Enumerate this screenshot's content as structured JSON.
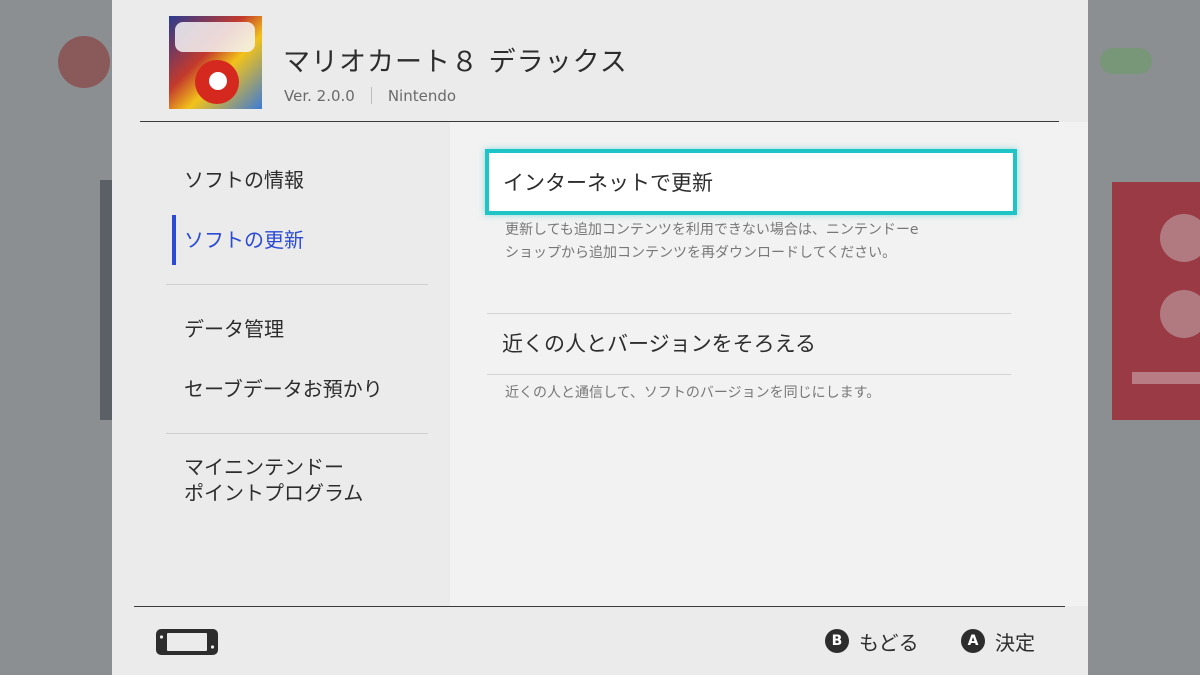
{
  "game": {
    "title": "マリオカート８ デラックス",
    "version": "Ver. 2.0.0",
    "publisher": "Nintendo"
  },
  "sidebar": {
    "items": [
      {
        "label": "ソフトの情報"
      },
      {
        "label": "ソフトの更新"
      },
      {
        "label": "データ管理"
      },
      {
        "label": "セーブデータお預かり"
      },
      {
        "label_line1": "マイニンテンドー",
        "label_line2": "ポイントプログラム"
      }
    ]
  },
  "content": {
    "option1": {
      "label": "インターネットで更新",
      "desc_line1": "更新しても追加コンテンツを利用できない場合は、ニンテンドーe",
      "desc_line2": "ショップから追加コンテンツを再ダウンロードしてください。"
    },
    "option2": {
      "label": "近くの人とバージョンをそろえる",
      "desc": "近くの人と通信して、ソフトのバージョンを同じにします。"
    }
  },
  "footer": {
    "back": {
      "glyph": "B",
      "label": "もどる"
    },
    "ok": {
      "glyph": "A",
      "label": "決定"
    }
  },
  "colors": {
    "accent": "#2b4bd6",
    "focus": "#1fc4c7"
  }
}
